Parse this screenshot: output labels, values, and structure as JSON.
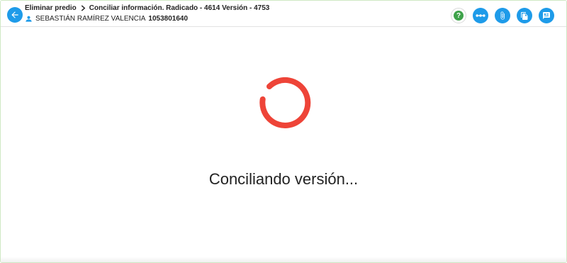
{
  "header": {
    "breadcrumb": {
      "parent": "Eliminar predio",
      "current": "Conciliar información. Radicado - 4614 Versión - 4753"
    },
    "user": {
      "name": "SEBASTIÁN RAMÍREZ VALENCIA",
      "id": "1053801640"
    },
    "help_label": "?"
  },
  "main": {
    "loading_message": "Conciliando versión..."
  },
  "icons": {
    "back": "arrow-left-icon",
    "user": "person-icon",
    "help": "help-icon",
    "flow": "flow-dots-icon",
    "attach": "paperclip-icon",
    "copy": "copy-icon",
    "notes": "notes-icon"
  },
  "colors": {
    "accent": "#1e9be9",
    "help_green": "#3ea24a",
    "spinner": "#ee4438"
  }
}
